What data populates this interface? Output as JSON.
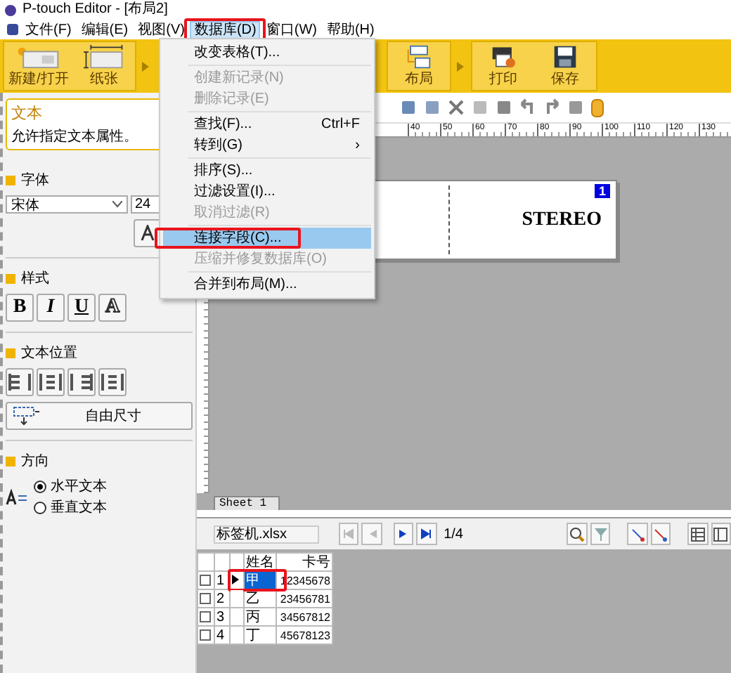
{
  "window": {
    "title": "P-touch Editor - [布局2]"
  },
  "menu_bar": [
    {
      "label": "文件(F)",
      "selected": false
    },
    {
      "label": "编辑(E)",
      "selected": false
    },
    {
      "label": "视图(V)",
      "selected": false
    },
    {
      "label": "数据库(D)",
      "selected": true
    },
    {
      "label": "窗口(W)",
      "selected": false
    },
    {
      "label": "帮助(H)",
      "selected": false
    }
  ],
  "ribbon": {
    "left": [
      {
        "label": "新建/打开",
        "kind": "new"
      },
      {
        "label": "纸张",
        "kind": "paper"
      }
    ],
    "right": [
      {
        "label": "布局",
        "kind": "layout"
      },
      {
        "label": "打印",
        "kind": "print"
      },
      {
        "label": "保存",
        "kind": "save"
      }
    ]
  },
  "properties": {
    "title": "文本",
    "description": "允许指定文本属性。",
    "font_heading": "字体",
    "font": "宋体",
    "size": "24",
    "style_heading": "样式",
    "style_buttons": [
      {
        "label": "B",
        "kind": "bold"
      },
      {
        "label": "I",
        "kind": "italic"
      },
      {
        "label": "U",
        "kind": "underline"
      },
      {
        "label": "A",
        "kind": "outline"
      }
    ],
    "position_heading": "文本位置",
    "size_button": "自由尺寸",
    "direction_heading": "方向",
    "directions": [
      {
        "label": "水平文本",
        "selected": true
      },
      {
        "label": "垂直文本",
        "selected": false
      }
    ]
  },
  "ruler_labels": [
    "40",
    "50",
    "60",
    "70",
    "80",
    "90",
    "100",
    "110",
    "120",
    "130"
  ],
  "label": {
    "text": "STEREO",
    "badge": "1"
  },
  "sheet_tab": "Sheet 1",
  "database": {
    "file": "标签机.xlsx",
    "record": "1/4",
    "columns": [
      "姓名",
      "卡号"
    ],
    "rows": [
      {
        "number": "1",
        "name": "甲",
        "card": "12345678",
        "selected": true,
        "checked": false
      },
      {
        "number": "2",
        "name": "乙",
        "card": "23456781",
        "selected": false,
        "checked": false
      },
      {
        "number": "3",
        "name": "丙",
        "card": "34567812",
        "selected": false,
        "checked": false
      },
      {
        "number": "4",
        "name": "丁",
        "card": "45678123",
        "selected": false,
        "checked": false
      }
    ]
  },
  "dropdown_menu": [
    {
      "kind": "item",
      "label": "改变表格(T)...",
      "disabled": false,
      "selected": false
    },
    {
      "kind": "separator"
    },
    {
      "kind": "item",
      "label": "创建新记录(N)",
      "disabled": true,
      "selected": false
    },
    {
      "kind": "item",
      "label": "删除记录(E)",
      "disabled": true,
      "selected": false
    },
    {
      "kind": "separator"
    },
    {
      "kind": "item",
      "label": "查找(F)...",
      "shortcut": "Ctrl+F",
      "disabled": false,
      "selected": false
    },
    {
      "kind": "submenu",
      "label": "转到(G)",
      "arrow": "›",
      "disabled": false,
      "selected": false
    },
    {
      "kind": "separator"
    },
    {
      "kind": "item",
      "label": "排序(S)...",
      "disabled": false,
      "selected": false
    },
    {
      "kind": "item",
      "label": "过滤设置(I)...",
      "disabled": false,
      "selected": false
    },
    {
      "kind": "item",
      "label": "取消过滤(R)",
      "disabled": true,
      "selected": false
    },
    {
      "kind": "separator"
    },
    {
      "kind": "item",
      "label": "连接字段(C)...",
      "disabled": false,
      "selected": true
    },
    {
      "kind": "item",
      "label": "压缩并修复数据库(O)",
      "disabled": true,
      "selected": false
    },
    {
      "kind": "separator"
    },
    {
      "kind": "item",
      "label": "合并到布局(M)...",
      "disabled": false,
      "selected": false
    }
  ]
}
